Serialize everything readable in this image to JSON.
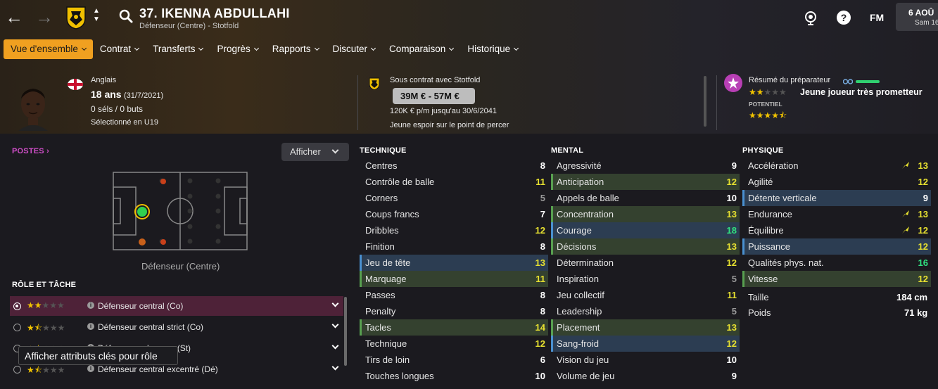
{
  "player": {
    "title": "37. IKENNA ABDULLAHI",
    "subtitle": "Défenseur (Centre) - Stotfold"
  },
  "date": {
    "line1": "6 AOÛ",
    "line2": "Sam 16"
  },
  "fm_label": "FM",
  "menu": [
    {
      "label": "Vue d'ensemble",
      "active": true
    },
    {
      "label": "Contrat"
    },
    {
      "label": "Transferts"
    },
    {
      "label": "Progrès"
    },
    {
      "label": "Rapports"
    },
    {
      "label": "Discuter"
    },
    {
      "label": "Comparaison"
    },
    {
      "label": "Historique"
    }
  ],
  "info": {
    "nationality": "Anglais",
    "age": "18 ans",
    "dob": "(31/7/2021)",
    "caps": "0 séls / 0 buts",
    "selection": "Sélectionné en U19",
    "contract_with": "Sous contrat avec Stotfold",
    "value": "39M € - 57M €",
    "wage": "120K € p/m jusqu'au 30/6/2041",
    "status": "Jeune espoir sur le point de percer",
    "coach_summary": "Résumé du préparateur",
    "coach_verdict": "Jeune joueur très prometteur",
    "potential_label": "POTENTIEL"
  },
  "positions": {
    "label": "POSTES",
    "show_button": "Afficher",
    "position_name": "Défenseur (Centre)"
  },
  "roles": {
    "label": "RÔLE ET TÂCHE",
    "items": [
      {
        "name": "Défenseur central (Co)",
        "stars": 2,
        "selected": true
      },
      {
        "name": "Défenseur central strict (Co)",
        "stars": 1.5
      },
      {
        "name": "Défenseur-relanceur (St)",
        "stars": 1.5
      },
      {
        "name": "Défenseur central excentré (Dé)",
        "stars": 1.5
      }
    ],
    "tooltip": "Afficher attributs clés pour rôle"
  },
  "technique": {
    "label": "TECHNIQUE",
    "rows": [
      {
        "name": "Centres",
        "value": 8,
        "color": "w"
      },
      {
        "name": "Contrôle de balle",
        "value": 11,
        "color": "y"
      },
      {
        "name": "Corners",
        "value": 5,
        "color": "gr"
      },
      {
        "name": "Coups francs",
        "value": 7,
        "color": "w"
      },
      {
        "name": "Dribbles",
        "value": 12,
        "color": "y"
      },
      {
        "name": "Finition",
        "value": 8,
        "color": "w"
      },
      {
        "name": "Jeu de tête",
        "value": 13,
        "color": "y",
        "hl": "b"
      },
      {
        "name": "Marquage",
        "value": 11,
        "color": "y",
        "hl": "g"
      },
      {
        "name": "Passes",
        "value": 8,
        "color": "w"
      },
      {
        "name": "Penalty",
        "value": 8,
        "color": "w"
      },
      {
        "name": "Tacles",
        "value": 14,
        "color": "y",
        "hl": "g"
      },
      {
        "name": "Technique",
        "value": 12,
        "color": "y"
      },
      {
        "name": "Tirs de loin",
        "value": 6,
        "color": "w"
      },
      {
        "name": "Touches longues",
        "value": 10,
        "color": "w"
      }
    ]
  },
  "mental": {
    "label": "MENTAL",
    "rows": [
      {
        "name": "Agressivité",
        "value": 9,
        "color": "w"
      },
      {
        "name": "Anticipation",
        "value": 12,
        "color": "y",
        "hl": "g"
      },
      {
        "name": "Appels de balle",
        "value": 10,
        "color": "w"
      },
      {
        "name": "Concentration",
        "value": 13,
        "color": "y",
        "hl": "g"
      },
      {
        "name": "Courage",
        "value": 18,
        "color": "g",
        "hl": "b"
      },
      {
        "name": "Décisions",
        "value": 13,
        "color": "y",
        "hl": "g"
      },
      {
        "name": "Détermination",
        "value": 12,
        "color": "y"
      },
      {
        "name": "Inspiration",
        "value": 5,
        "color": "gr"
      },
      {
        "name": "Jeu collectif",
        "value": 11,
        "color": "y"
      },
      {
        "name": "Leadership",
        "value": 5,
        "color": "gr"
      },
      {
        "name": "Placement",
        "value": 13,
        "color": "y",
        "hl": "g"
      },
      {
        "name": "Sang-froid",
        "value": 12,
        "color": "y",
        "hl": "b"
      },
      {
        "name": "Vision du jeu",
        "value": 10,
        "color": "w"
      },
      {
        "name": "Volume de jeu",
        "value": 9,
        "color": "w"
      }
    ]
  },
  "physique": {
    "label": "PHYSIQUE",
    "rows": [
      {
        "name": "Accélération",
        "value": 13,
        "color": "y",
        "trend": true
      },
      {
        "name": "Agilité",
        "value": 12,
        "color": "y"
      },
      {
        "name": "Détente verticale",
        "value": 9,
        "color": "w",
        "hl": "b"
      },
      {
        "name": "Endurance",
        "value": 13,
        "color": "y",
        "trend": true
      },
      {
        "name": "Équilibre",
        "value": 12,
        "color": "y",
        "trend": true
      },
      {
        "name": "Puissance",
        "value": 12,
        "color": "y",
        "hl": "b"
      },
      {
        "name": "Qualités phys. nat.",
        "value": 16,
        "color": "g"
      },
      {
        "name": "Vitesse",
        "value": 12,
        "color": "y",
        "hl": "g"
      }
    ],
    "height_label": "Taille",
    "height_value": "184 cm",
    "weight_label": "Poids",
    "weight_value": "71 kg"
  },
  "colors": {
    "accent": "#f0a020",
    "highlight_green": "#34412f",
    "highlight_blue": "#2c3d52",
    "attr_yellow": "#e6e030",
    "attr_green": "#30e080",
    "role_selected": "#4e2238"
  }
}
